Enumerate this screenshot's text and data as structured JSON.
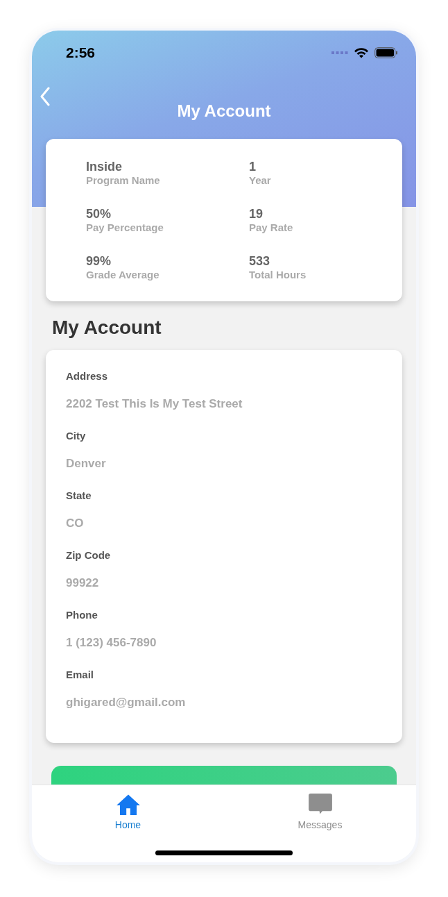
{
  "status_bar": {
    "time": "2:56"
  },
  "nav": {
    "title": "My Account"
  },
  "stats": [
    {
      "value": "Inside",
      "label": "Program Name"
    },
    {
      "value": "1",
      "label": "Year"
    },
    {
      "value": "50%",
      "label": "Pay Percentage"
    },
    {
      "value": "19",
      "label": "Pay Rate"
    },
    {
      "value": "99%",
      "label": "Grade Average"
    },
    {
      "value": "533",
      "label": "Total Hours"
    }
  ],
  "section_title": "My Account",
  "fields": [
    {
      "label": "Address",
      "value": "2202 Test This Is My Test Street"
    },
    {
      "label": "City",
      "value": "Denver"
    },
    {
      "label": "State",
      "value": "CO"
    },
    {
      "label": "Zip Code",
      "value": "99922"
    },
    {
      "label": "Phone",
      "value": "1 (123) 456-7890"
    },
    {
      "label": "Email",
      "value": "ghigared@gmail.com"
    }
  ],
  "tabs": [
    {
      "label": "Home",
      "kind": "home",
      "selected": true
    },
    {
      "label": "Messages",
      "kind": "messages",
      "selected": false
    }
  ]
}
